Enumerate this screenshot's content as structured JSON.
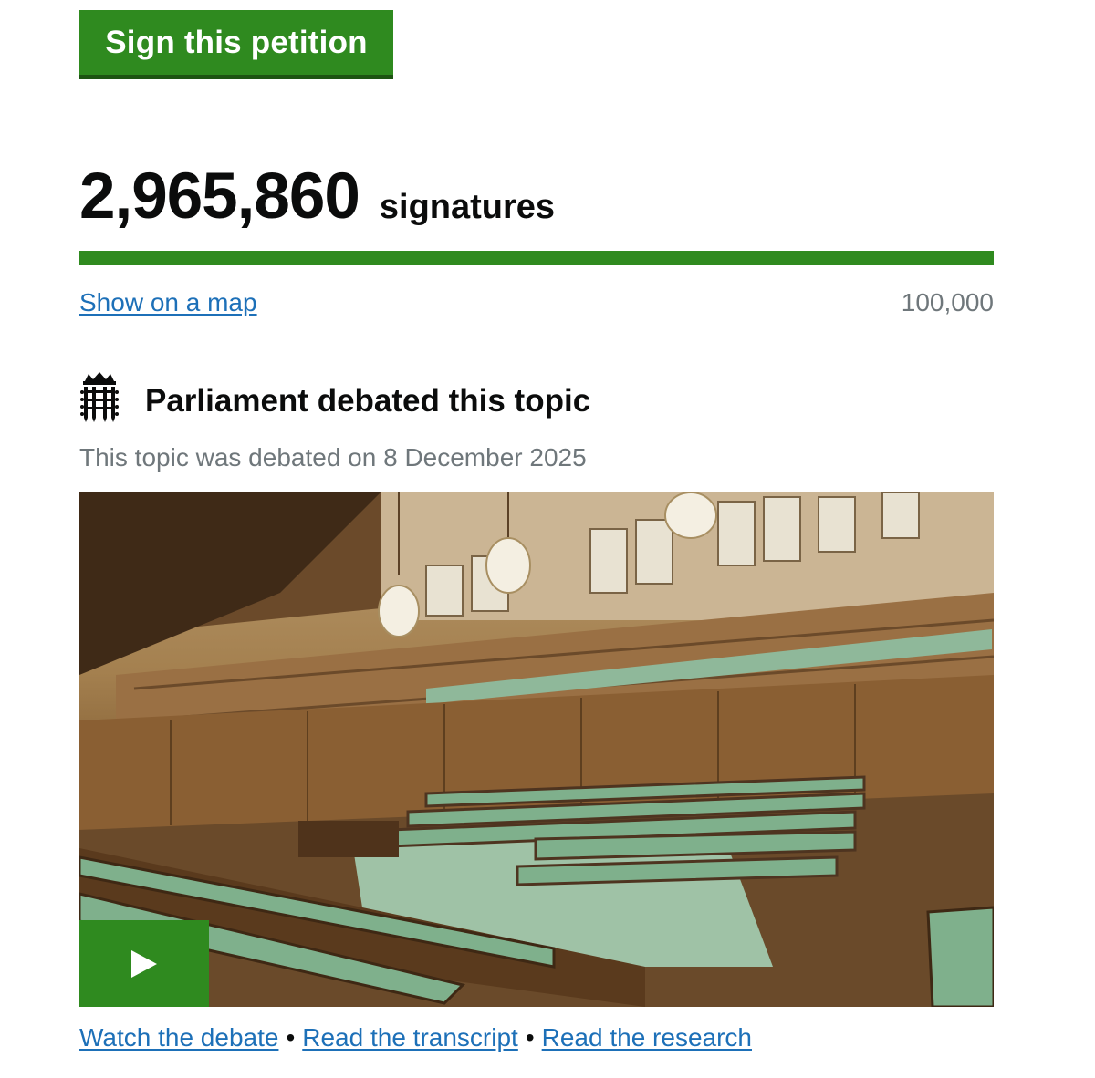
{
  "sign_button": {
    "label": "Sign this petition"
  },
  "signatures": {
    "count": "2,965,860",
    "label": "signatures"
  },
  "progress": {
    "fraction": 1.0,
    "color": "#2f8a1f"
  },
  "map_link": {
    "label": "Show on a map"
  },
  "threshold": {
    "label": "100,000"
  },
  "debate": {
    "icon": "portcullis-icon",
    "heading": "Parliament debated this topic",
    "date_text": "This topic was debated on 8 December 2025",
    "image": "house-of-commons-chamber-photo",
    "play_icon": "play-icon"
  },
  "links": {
    "watch": "Watch the debate",
    "separator": "•",
    "transcript": "Read the transcript",
    "research": "Read the research"
  },
  "colors": {
    "accent_green": "#2f8a1f",
    "link_blue": "#1d70b8",
    "muted_grey": "#6f777b"
  }
}
